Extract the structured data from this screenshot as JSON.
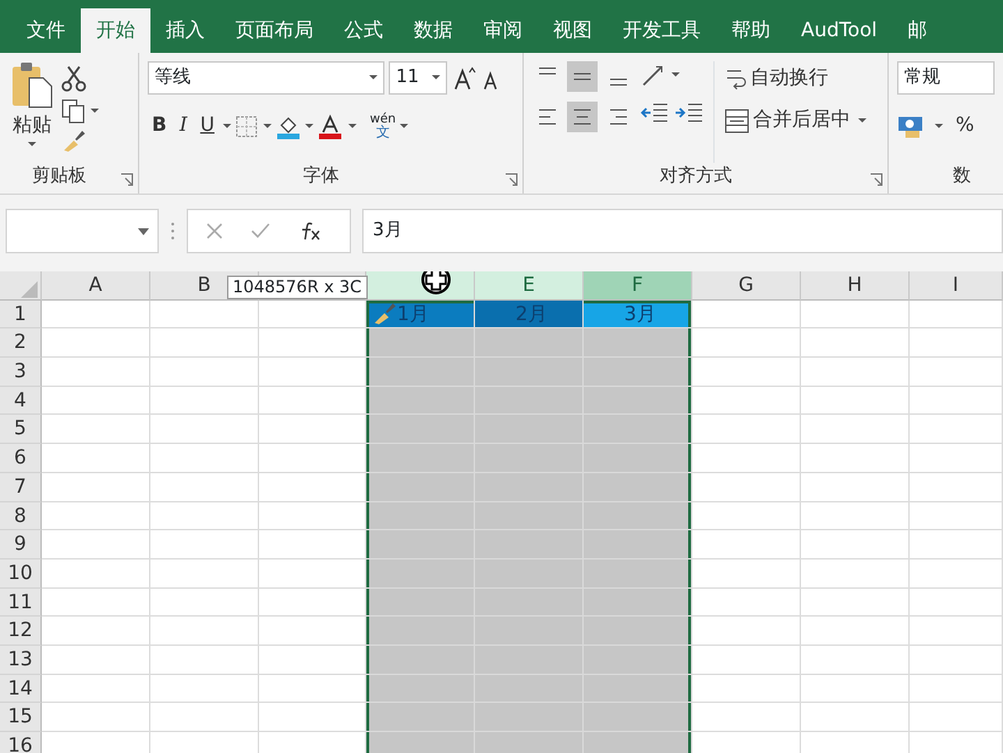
{
  "tabs": [
    {
      "label": "文件",
      "selected": false
    },
    {
      "label": "开始",
      "selected": true
    },
    {
      "label": "插入",
      "selected": false
    },
    {
      "label": "页面布局",
      "selected": false
    },
    {
      "label": "公式",
      "selected": false
    },
    {
      "label": "数据",
      "selected": false
    },
    {
      "label": "审阅",
      "selected": false
    },
    {
      "label": "视图",
      "selected": false
    },
    {
      "label": "开发工具",
      "selected": false
    },
    {
      "label": "帮助",
      "selected": false
    },
    {
      "label": "AudTool",
      "selected": false
    },
    {
      "label": "邮",
      "selected": false
    }
  ],
  "ribbon": {
    "clipboard": {
      "paste_label": "粘贴",
      "group_label": "剪贴板"
    },
    "font": {
      "font_name": "等线",
      "font_size": "11",
      "bold": "B",
      "italic": "I",
      "underline": "U",
      "phonetic_top": "wén",
      "phonetic_bottom": "文",
      "group_label": "字体"
    },
    "alignment": {
      "wrap_text": "自动换行",
      "merge_center": "合并后居中",
      "group_label": "对齐方式"
    },
    "number": {
      "format": "常规",
      "percent": "%",
      "group_label": "数"
    }
  },
  "formula_bar": {
    "formula": "3月"
  },
  "selection_tooltip": "1048576R x 3C",
  "grid": {
    "columns": [
      {
        "label": "A",
        "selected": false,
        "active": false
      },
      {
        "label": "B",
        "selected": false,
        "active": false
      },
      {
        "selected": false,
        "active": false
      },
      {
        "selected": true,
        "active": false,
        "first_row": {
          "text": "1月",
          "color": "#0b7cbf"
        }
      },
      {
        "label": "E",
        "selected": true,
        "active": false,
        "first_row": {
          "text": "2月",
          "color": "#0a6fae"
        }
      },
      {
        "label": "F",
        "selected": true,
        "active": true,
        "first_row": {
          "text": "3月",
          "color": "#17a5e6"
        }
      },
      {
        "label": "G",
        "selected": false,
        "active": false
      },
      {
        "label": "H",
        "selected": false,
        "active": false
      },
      {
        "label": "I",
        "selected": false,
        "active": false
      }
    ],
    "rows": [
      "1",
      "2",
      "3",
      "4",
      "5",
      "6",
      "7",
      "8",
      "9",
      "10",
      "11",
      "12",
      "13",
      "14",
      "15",
      "16"
    ]
  }
}
